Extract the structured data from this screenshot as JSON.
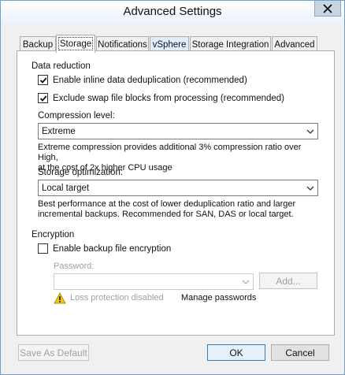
{
  "window": {
    "title": "Advanced Settings"
  },
  "tabs": [
    {
      "label": "Backup"
    },
    {
      "label": "Storage"
    },
    {
      "label": "Notifications"
    },
    {
      "label": "vSphere"
    },
    {
      "label": "Storage Integration"
    },
    {
      "label": "Advanced"
    }
  ],
  "data_reduction": {
    "group_label": "Data reduction",
    "inline_dedup_label": "Enable inline data deduplication (recommended)",
    "inline_dedup_checked": true,
    "exclude_swap_label": "Exclude swap file blocks from processing (recommended)",
    "exclude_swap_checked": true,
    "compression_label": "Compression level:",
    "compression_value": "Extreme",
    "compression_desc_line1": "Extreme compression provides additional 3% compression ratio over High,",
    "compression_desc_line2": "at the cost of 2x higher CPU usage",
    "storage_opt_label": "Storage optimization:",
    "storage_opt_value": "Local target",
    "storage_desc_line1": "Best performance at the cost of lower deduplication ratio and larger",
    "storage_desc_line2": "incremental backups. Recommended for SAN, DAS or local target."
  },
  "encryption": {
    "group_label": "Encryption",
    "enable_label": "Enable backup file encryption",
    "enable_checked": false,
    "password_label": "Password:",
    "password_value": "",
    "add_label": "Add...",
    "warning_text": "Loss protection disabled",
    "manage_link": "Manage passwords"
  },
  "footer": {
    "save_default_label": "Save As Default",
    "ok_label": "OK",
    "cancel_label": "Cancel"
  }
}
